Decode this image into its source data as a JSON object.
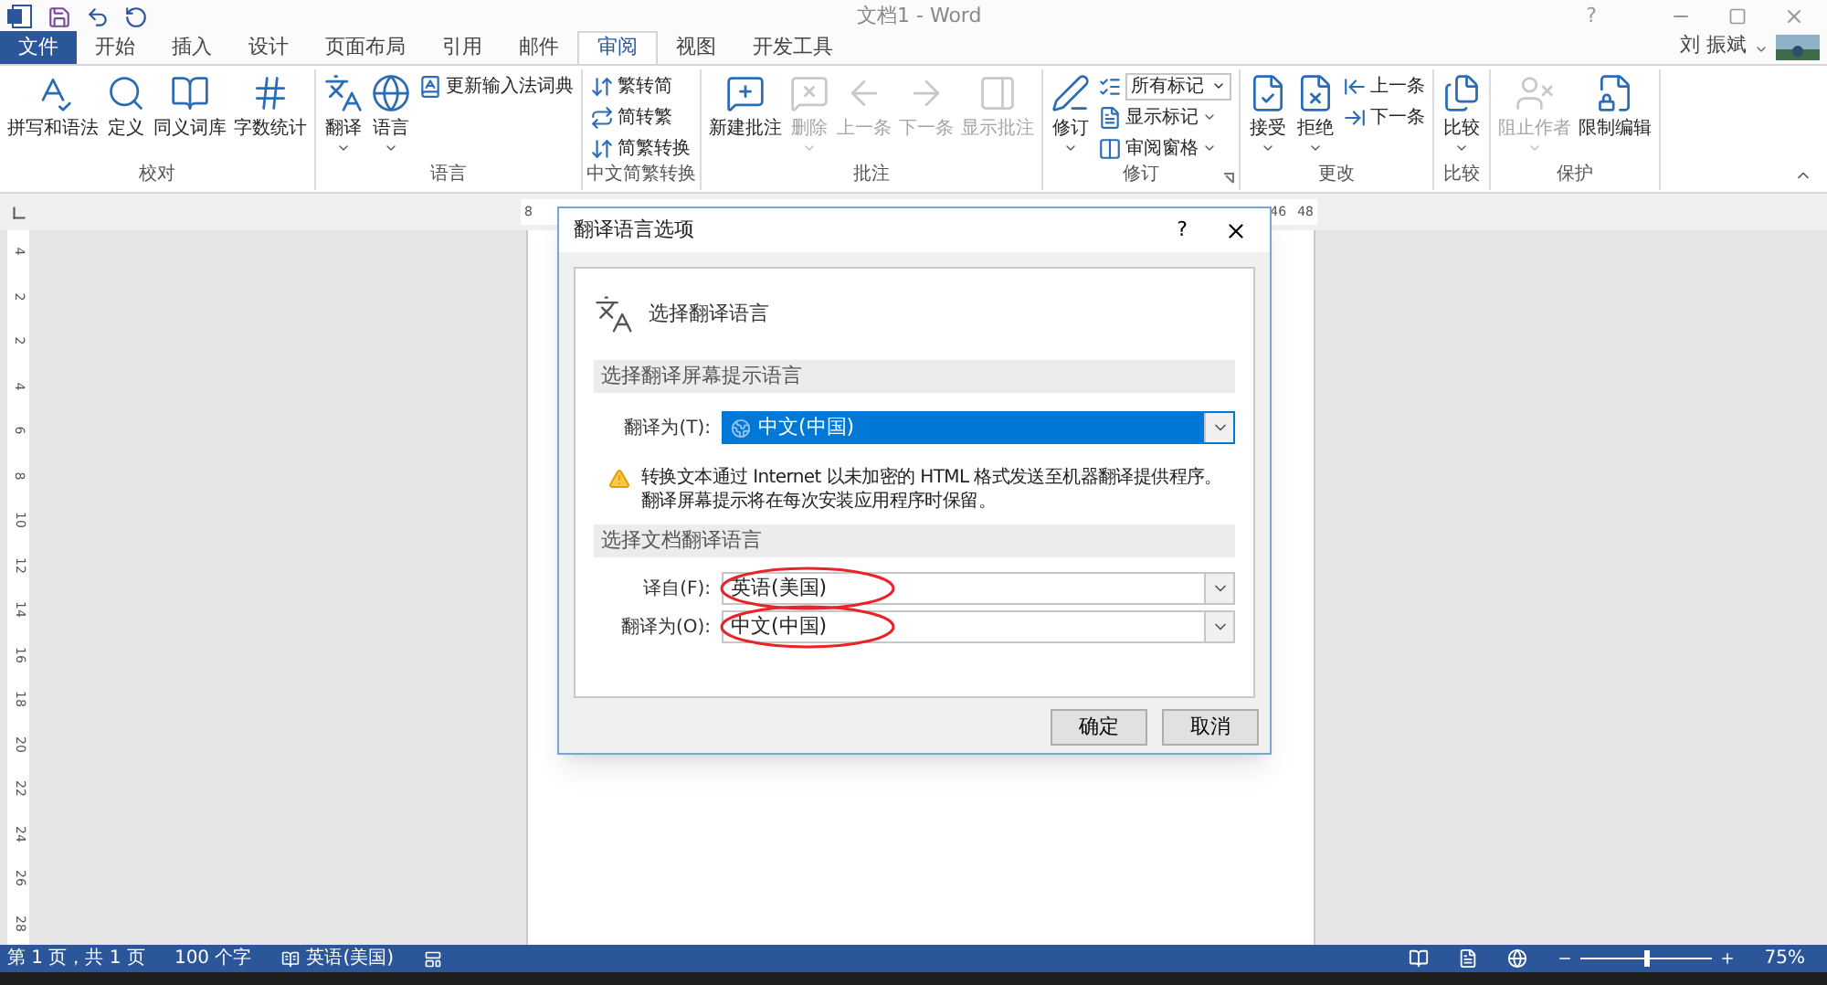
{
  "title_bar": {
    "title": "文档1 - Word",
    "help": "?",
    "user": "刘 振斌"
  },
  "tabs": [
    {
      "label": "文件",
      "kind": "file",
      "selected": false
    },
    {
      "label": "开始",
      "kind": "tab",
      "selected": false
    },
    {
      "label": "插入",
      "kind": "tab",
      "selected": false
    },
    {
      "label": "设计",
      "kind": "tab",
      "selected": false
    },
    {
      "label": "页面布局",
      "kind": "tab",
      "selected": false
    },
    {
      "label": "引用",
      "kind": "tab",
      "selected": false
    },
    {
      "label": "邮件",
      "kind": "tab",
      "selected": false
    },
    {
      "label": "审阅",
      "kind": "tab",
      "selected": true
    },
    {
      "label": "视图",
      "kind": "tab",
      "selected": false
    },
    {
      "label": "开发工具",
      "kind": "tab",
      "selected": false
    }
  ],
  "ribbon": [
    {
      "label": "校对",
      "items": [
        {
          "kind": "large",
          "label": "拼写和语法",
          "disabled": false,
          "dropdown": false
        },
        {
          "kind": "large",
          "label": "定义",
          "disabled": false,
          "dropdown": false
        },
        {
          "kind": "large",
          "label": "同义词库",
          "disabled": false,
          "dropdown": false
        },
        {
          "kind": "large",
          "label": "字数统计",
          "disabled": false,
          "dropdown": false
        }
      ]
    },
    {
      "label": "语言",
      "items": [
        {
          "kind": "large",
          "label": "翻译",
          "disabled": false,
          "dropdown": true
        },
        {
          "kind": "large",
          "label": "语言",
          "disabled": false,
          "dropdown": true
        },
        {
          "kind": "small",
          "label": "更新输入法词典",
          "disabled": false,
          "dropdown": false
        }
      ]
    },
    {
      "label": "中文简繁转换",
      "items": [
        {
          "kind": "small",
          "label": "繁转简",
          "disabled": false,
          "dropdown": false
        },
        {
          "kind": "small",
          "label": "简转繁",
          "disabled": false,
          "dropdown": false
        },
        {
          "kind": "small",
          "label": "简繁转换",
          "disabled": false,
          "dropdown": false
        }
      ]
    },
    {
      "label": "批注",
      "items": [
        {
          "kind": "large",
          "label": "新建批注",
          "disabled": false,
          "dropdown": false
        },
        {
          "kind": "large",
          "label": "删除",
          "disabled": true,
          "dropdown": true
        },
        {
          "kind": "large",
          "label": "上一条",
          "disabled": true,
          "dropdown": false
        },
        {
          "kind": "large",
          "label": "下一条",
          "disabled": true,
          "dropdown": false
        },
        {
          "kind": "large",
          "label": "显示批注",
          "disabled": true,
          "dropdown": false
        }
      ]
    },
    {
      "label": "修订",
      "launcher": true,
      "items": [
        {
          "kind": "large",
          "label": "修订",
          "disabled": false,
          "dropdown": true
        },
        {
          "kind": "combo",
          "label": "所有标记",
          "disabled": false,
          "dropdown": true
        },
        {
          "kind": "small",
          "label": "显示标记",
          "disabled": false,
          "dropdown": true
        },
        {
          "kind": "small",
          "label": "审阅窗格",
          "disabled": false,
          "dropdown": true
        }
      ]
    },
    {
      "label": "更改",
      "items": [
        {
          "kind": "large",
          "label": "接受",
          "disabled": false,
          "dropdown": true
        },
        {
          "kind": "large",
          "label": "拒绝",
          "disabled": false,
          "dropdown": true
        },
        {
          "kind": "small",
          "label": "上一条",
          "disabled": false,
          "dropdown": false
        },
        {
          "kind": "small",
          "label": "下一条",
          "disabled": false,
          "dropdown": false
        }
      ]
    },
    {
      "label": "比较",
      "items": [
        {
          "kind": "large",
          "label": "比较",
          "disabled": false,
          "dropdown": true
        }
      ]
    },
    {
      "label": "保护",
      "items": [
        {
          "kind": "large",
          "label": "阻止作者",
          "disabled": true,
          "dropdown": true
        },
        {
          "kind": "large",
          "label": "限制编辑",
          "disabled": false,
          "dropdown": false
        }
      ]
    }
  ],
  "ruler": {
    "horizontal": [
      "8",
      "46",
      "48"
    ],
    "vertical": [
      "4",
      "2",
      "2",
      "4",
      "6",
      "8",
      "10",
      "12",
      "14",
      "16",
      "18",
      "20",
      "22",
      "24",
      "26",
      "28"
    ]
  },
  "dialog": {
    "title": "翻译语言选项",
    "help": "?",
    "heading": "选择翻译语言",
    "section_1": "选择翻译屏幕提示语言",
    "screentip_label": "翻译为(T):",
    "screentip_value": "中文(中国)",
    "warning": [
      "转换文本通过 Internet 以未加密的 HTML 格式发送至机器翻译提供程序。",
      "翻译屏幕提示将在每次安装应用程序时保留。"
    ],
    "section_2": "选择文档翻译语言",
    "from_label": "译自(F):",
    "from_value": "英语(美国)",
    "to_label": "翻译为(O):",
    "to_value": "中文(中国)",
    "buttons": [
      "确定",
      "取消"
    ]
  },
  "status_bar": {
    "page": "第 1 页，共 1 页",
    "words": "100 个字",
    "language": "英语(美国)",
    "zoom": "75%",
    "zoom_slider": {
      "level": 0.5
    }
  }
}
